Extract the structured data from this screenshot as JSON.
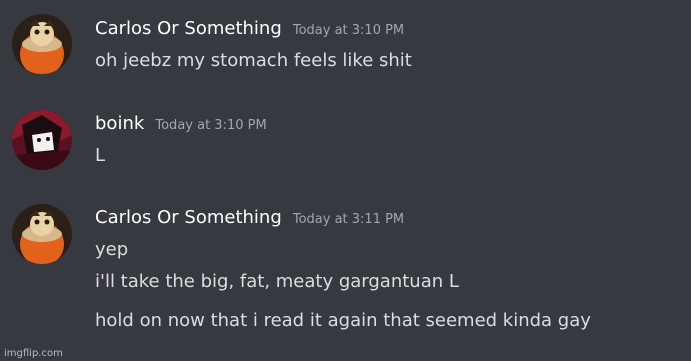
{
  "messages": [
    {
      "username": "Carlos Or Something",
      "timestamp": "Today at 3:10 PM",
      "avatar": "carlos-avatar",
      "lines": [
        "oh jeebz my stomach feels like shit"
      ]
    },
    {
      "username": "boink",
      "timestamp": "Today at 3:10 PM",
      "avatar": "boink-avatar",
      "lines": [
        "L"
      ]
    },
    {
      "username": "Carlos Or Something",
      "timestamp": "Today at 3:11 PM",
      "avatar": "carlos-avatar",
      "lines": [
        "yep",
        "i'll take the big, fat, meaty gargantuan L",
        "hold on now that i read it again that seemed kinda gay"
      ]
    }
  ],
  "watermark": "imgflip.com",
  "colors": {
    "background": "#36393f",
    "username": "#ffffff",
    "message_text": "#dcddde",
    "timestamp": "#a3a6aa"
  }
}
